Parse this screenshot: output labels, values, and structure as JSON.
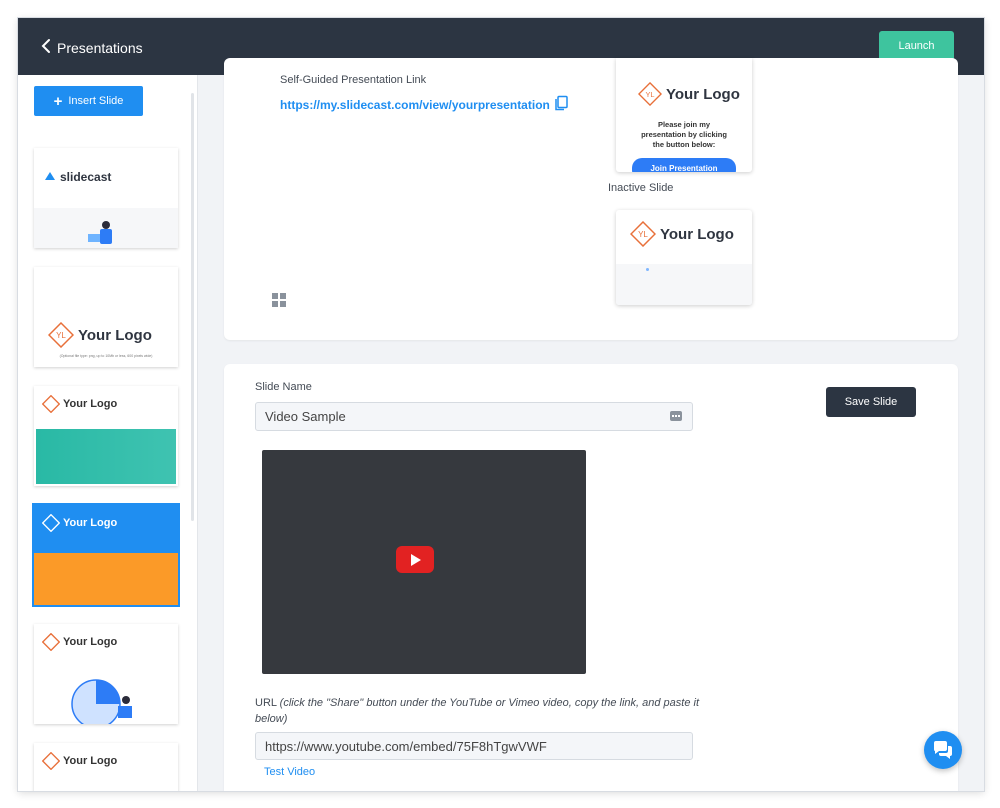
{
  "topbar": {
    "title": "Presentations",
    "launch_label": "Launch"
  },
  "sidebar": {
    "insert_label": "Insert Slide",
    "thumbs": [
      {
        "logo": "slidecast"
      },
      {
        "logo": "Your Logo",
        "caption": "(Optional file type: png, up to 10Mb or less, 600 pixels wide)"
      },
      {
        "logo": "Your Logo"
      },
      {
        "logo": "Your Logo"
      },
      {
        "logo": "Your Logo"
      },
      {
        "logo": "Your Logo"
      }
    ]
  },
  "top_panel": {
    "link_label": "Self-Guided Presentation Link",
    "link_url": "https://my.slidecast.com/view/yourpresentation",
    "card1": {
      "logo": "Your Logo",
      "join_text": "Please join my presentation by clicking the button below:",
      "join_btn": "Join Presentation"
    },
    "inactive_label": "Inactive Slide",
    "card2": {
      "logo": "Your Logo"
    }
  },
  "editor": {
    "slide_name_label": "Slide Name",
    "slide_name_value": "Video Sample",
    "save_label": "Save Slide",
    "url_label": "URL ",
    "url_hint": "(click the \"Share\" button under the YouTube or Vimeo video, copy the link, and paste it below)",
    "url_value": "https://www.youtube.com/embed/75F8hTgwVWF",
    "test_video": "Test Video"
  },
  "colors": {
    "accent": "#1f8ef1",
    "launch": "#3ec49e",
    "header": "#2c3542",
    "logo_orange": "#e8703a"
  }
}
